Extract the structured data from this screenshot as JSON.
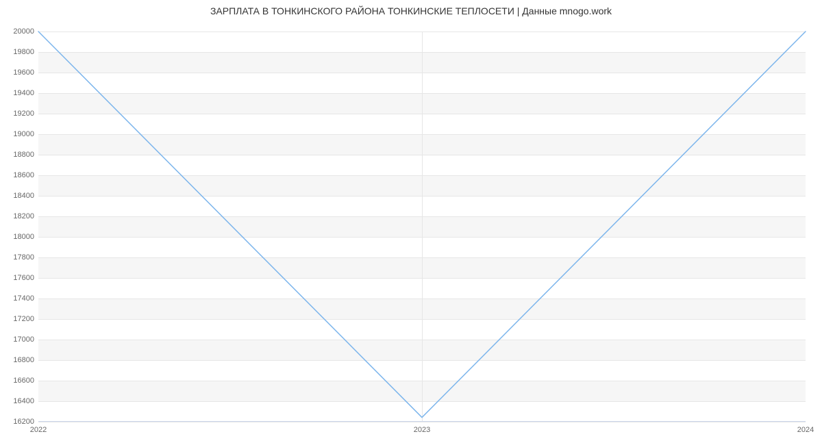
{
  "chart_data": {
    "type": "line",
    "title": "ЗАРПЛАТА В ТОНКИНСКОГО РАЙОНА ТОНКИНСКИЕ ТЕПЛОСЕТИ | Данные mnogo.work",
    "x": [
      2022,
      2023,
      2024
    ],
    "values": [
      20000,
      16242,
      20000
    ],
    "xlabel": "",
    "ylabel": "",
    "ylim": [
      16200,
      20000
    ],
    "y_ticks": [
      16200,
      16400,
      16600,
      16800,
      17000,
      17200,
      17400,
      17600,
      17800,
      18000,
      18200,
      18400,
      18600,
      18800,
      19000,
      19200,
      19400,
      19600,
      19800,
      20000
    ],
    "x_ticks": [
      2022,
      2023,
      2024
    ],
    "grid": true,
    "line_color": "#7cb5ec"
  }
}
